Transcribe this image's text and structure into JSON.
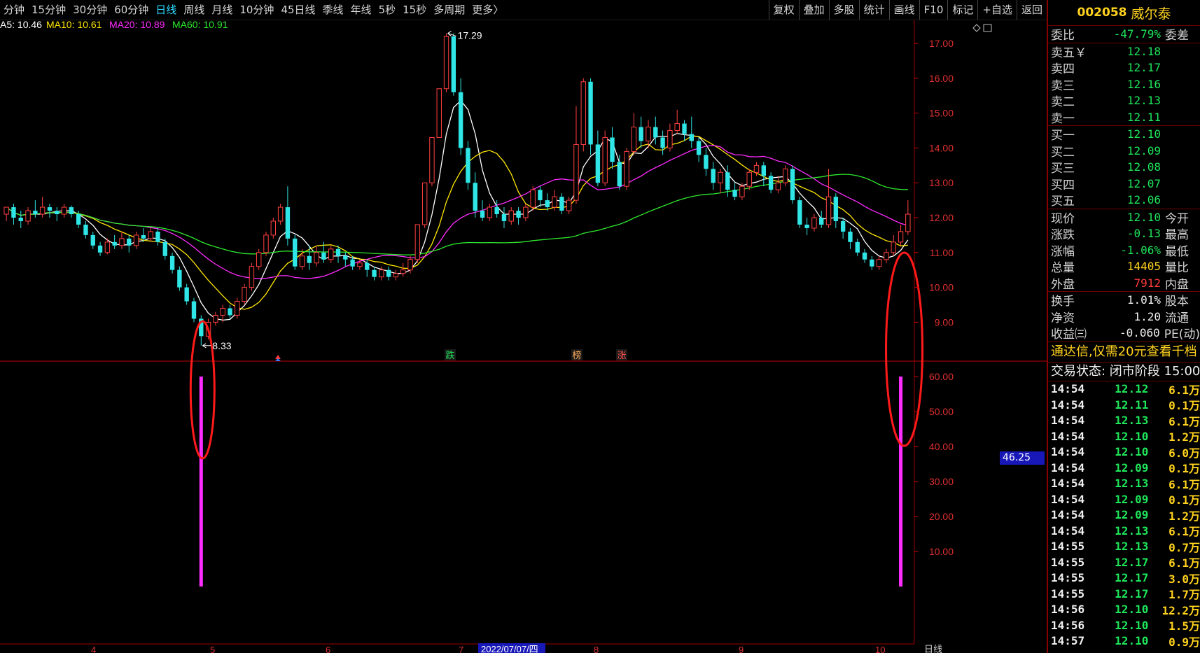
{
  "toolbar": {
    "periods": [
      {
        "label": "分钟",
        "active": false
      },
      {
        "label": "15分钟",
        "active": false
      },
      {
        "label": "30分钟",
        "active": false
      },
      {
        "label": "60分钟",
        "active": false
      },
      {
        "label": "日线",
        "active": true
      },
      {
        "label": "周线",
        "active": false
      },
      {
        "label": "月线",
        "active": false
      },
      {
        "label": "10分钟",
        "active": false
      },
      {
        "label": "45日线",
        "active": false
      },
      {
        "label": "季线",
        "active": false
      },
      {
        "label": "年线",
        "active": false
      },
      {
        "label": "5秒",
        "active": false
      },
      {
        "label": "15秒",
        "active": false
      },
      {
        "label": "多周期",
        "active": false
      },
      {
        "label": "更多〉",
        "active": false
      }
    ],
    "tools": [
      "复权",
      "叠加",
      "多股",
      "统计",
      "画线",
      "F10",
      "标记",
      "+自选",
      "返回"
    ]
  },
  "indicators": [
    {
      "label": "A5: 10.46",
      "color": "#ffffff"
    },
    {
      "label": "MA10: 10.61",
      "color": "#ffe600"
    },
    {
      "label": "MA20: 10.89",
      "color": "#ff2cff"
    },
    {
      "label": "MA60: 10.91",
      "color": "#2ee82e"
    }
  ],
  "price_axis": [
    "17.00",
    "16.00",
    "15.00",
    "14.00",
    "13.00",
    "12.00",
    "11.00",
    "10.00",
    "9.00"
  ],
  "sub_axis": [
    "60.00",
    "50.00",
    "40.00",
    "30.00",
    "20.00",
    "10.00"
  ],
  "sub_value_tag": "46.25",
  "chart_annotations": {
    "high": "17.29",
    "low": "8.33"
  },
  "event_markers": [
    "跌",
    "榜",
    "涨"
  ],
  "date_axis": {
    "months": [
      "4",
      "5",
      "6",
      "7",
      "8",
      "9",
      "10"
    ],
    "cursor_date": "2022/07/07/四",
    "right_label": "日线"
  },
  "chart_data": {
    "type": "candlestick",
    "price_range": [
      8.2,
      17.6
    ],
    "sub_range": [
      0,
      65
    ],
    "candles": [
      [
        12.1,
        12.3,
        12.3,
        11.9
      ],
      [
        12.3,
        12.0,
        12.4,
        11.8
      ],
      [
        12.0,
        11.9,
        12.2,
        11.7
      ],
      [
        11.9,
        12.2,
        12.3,
        11.8
      ],
      [
        12.2,
        12.1,
        12.5,
        12.0
      ],
      [
        12.1,
        12.3,
        12.6,
        12.0
      ],
      [
        12.3,
        12.2,
        12.4,
        12.0
      ],
      [
        12.2,
        12.1,
        12.3,
        11.9
      ],
      [
        12.1,
        12.3,
        12.4,
        12.0
      ],
      [
        12.3,
        12.1,
        12.35,
        12.0
      ],
      [
        12.1,
        11.8,
        12.2,
        11.7
      ],
      [
        11.8,
        11.5,
        11.9,
        11.4
      ],
      [
        11.5,
        11.2,
        11.6,
        11.1
      ],
      [
        11.2,
        11.0,
        11.3,
        10.9
      ],
      [
        11.0,
        11.3,
        11.4,
        10.95
      ],
      [
        11.3,
        11.2,
        11.5,
        11.1
      ],
      [
        11.2,
        11.4,
        11.6,
        11.1
      ],
      [
        11.4,
        11.2,
        11.5,
        11.0
      ],
      [
        11.2,
        11.5,
        11.6,
        11.1
      ],
      [
        11.5,
        11.4,
        11.7,
        11.3
      ],
      [
        11.4,
        11.6,
        11.7,
        11.3
      ],
      [
        11.6,
        11.3,
        11.7,
        11.2
      ],
      [
        11.3,
        10.9,
        11.4,
        10.8
      ],
      [
        10.9,
        10.5,
        11.0,
        10.4
      ],
      [
        10.5,
        10.0,
        10.6,
        9.9
      ],
      [
        10.0,
        9.6,
        10.1,
        9.5
      ],
      [
        9.6,
        9.1,
        9.7,
        9.0
      ],
      [
        9.1,
        8.6,
        9.2,
        8.33
      ],
      [
        8.6,
        9.0,
        9.1,
        8.5
      ],
      [
        9.0,
        9.2,
        9.3,
        8.9
      ],
      [
        9.2,
        9.4,
        9.5,
        9.0
      ],
      [
        9.4,
        9.2,
        9.5,
        9.1
      ],
      [
        9.2,
        9.6,
        9.7,
        9.1
      ],
      [
        9.6,
        10.0,
        10.1,
        9.5
      ],
      [
        10.0,
        10.6,
        10.7,
        9.9
      ],
      [
        10.6,
        11.0,
        11.1,
        10.5
      ],
      [
        11.0,
        11.5,
        11.6,
        10.9
      ],
      [
        11.5,
        11.9,
        12.0,
        11.4
      ],
      [
        11.9,
        12.3,
        12.4,
        11.8
      ],
      [
        12.3,
        11.4,
        12.9,
        11.2
      ],
      [
        11.4,
        10.6,
        11.5,
        10.5
      ],
      [
        10.6,
        10.9,
        11.1,
        10.5
      ],
      [
        10.9,
        10.7,
        11.2,
        10.5
      ],
      [
        10.7,
        11.0,
        11.2,
        10.6
      ],
      [
        11.0,
        10.8,
        11.3,
        10.7
      ],
      [
        10.8,
        11.1,
        11.2,
        10.7
      ],
      [
        11.1,
        10.9,
        11.2,
        10.7
      ],
      [
        10.9,
        10.8,
        11.0,
        10.6
      ],
      [
        10.8,
        10.6,
        10.9,
        10.5
      ],
      [
        10.6,
        10.7,
        10.8,
        10.5
      ],
      [
        10.7,
        10.5,
        10.8,
        10.3
      ],
      [
        10.5,
        10.3,
        10.6,
        10.2
      ],
      [
        10.3,
        10.5,
        10.6,
        10.2
      ],
      [
        10.5,
        10.3,
        10.6,
        10.2
      ],
      [
        10.3,
        10.4,
        10.5,
        10.2
      ],
      [
        10.4,
        10.5,
        10.7,
        10.3
      ],
      [
        10.5,
        10.8,
        10.9,
        10.4
      ],
      [
        10.8,
        11.8,
        11.8,
        10.7
      ],
      [
        11.8,
        13.0,
        13.0,
        11.7
      ],
      [
        13.0,
        14.3,
        14.3,
        12.9
      ],
      [
        14.3,
        15.7,
        15.7,
        14.3
      ],
      [
        15.7,
        17.2,
        17.29,
        15.6
      ],
      [
        17.2,
        15.6,
        17.29,
        15.5
      ],
      [
        15.6,
        14.0,
        16.0,
        13.8
      ],
      [
        14.0,
        13.0,
        14.2,
        12.8
      ],
      [
        13.0,
        12.2,
        13.3,
        12.0
      ],
      [
        12.2,
        12.0,
        12.5,
        11.9
      ],
      [
        12.0,
        12.3,
        12.4,
        11.9
      ],
      [
        12.3,
        12.1,
        12.5,
        12.0
      ],
      [
        12.1,
        11.9,
        12.3,
        11.7
      ],
      [
        11.9,
        12.2,
        12.3,
        11.8
      ],
      [
        12.2,
        12.0,
        12.3,
        11.8
      ],
      [
        12.0,
        12.3,
        12.4,
        11.9
      ],
      [
        12.3,
        12.8,
        12.9,
        12.2
      ],
      [
        12.8,
        12.5,
        12.9,
        12.3
      ],
      [
        12.5,
        12.3,
        12.7,
        12.2
      ],
      [
        12.3,
        12.6,
        12.8,
        12.2
      ],
      [
        12.6,
        12.2,
        12.7,
        12.1
      ],
      [
        12.2,
        12.5,
        12.6,
        12.1
      ],
      [
        12.5,
        14.1,
        15.2,
        12.4
      ],
      [
        14.1,
        15.9,
        16.0,
        13.9
      ],
      [
        15.9,
        14.1,
        16.0,
        13.8
      ],
      [
        14.1,
        13.0,
        14.5,
        12.9
      ],
      [
        13.0,
        14.3,
        14.5,
        12.9
      ],
      [
        14.3,
        13.6,
        14.6,
        13.4
      ],
      [
        13.6,
        12.9,
        13.8,
        12.8
      ],
      [
        12.9,
        13.9,
        14.0,
        12.8
      ],
      [
        13.9,
        14.6,
        15.0,
        13.8
      ],
      [
        14.6,
        14.2,
        14.9,
        14.0
      ],
      [
        14.2,
        14.6,
        14.8,
        14.0
      ],
      [
        14.6,
        14.3,
        14.9,
        14.1
      ],
      [
        14.3,
        14.0,
        14.5,
        13.8
      ],
      [
        14.0,
        14.5,
        14.7,
        13.9
      ],
      [
        14.5,
        14.7,
        15.1,
        14.4
      ],
      [
        14.7,
        14.4,
        14.8,
        14.2
      ],
      [
        14.4,
        14.2,
        14.9,
        14.0
      ],
      [
        14.2,
        13.8,
        14.3,
        13.6
      ],
      [
        13.8,
        13.4,
        14.0,
        13.2
      ],
      [
        13.4,
        13.0,
        13.6,
        12.8
      ],
      [
        13.0,
        13.3,
        13.4,
        12.7
      ],
      [
        13.3,
        12.8,
        13.5,
        12.6
      ],
      [
        12.8,
        12.6,
        13.0,
        12.5
      ],
      [
        12.6,
        12.9,
        13.0,
        12.5
      ],
      [
        12.9,
        13.3,
        13.4,
        12.8
      ],
      [
        13.3,
        13.5,
        13.6,
        13.2
      ],
      [
        13.5,
        13.2,
        13.6,
        12.9
      ],
      [
        13.2,
        12.8,
        13.3,
        12.7
      ],
      [
        12.8,
        13.0,
        13.2,
        12.7
      ],
      [
        13.0,
        13.4,
        13.5,
        12.9
      ],
      [
        13.4,
        12.5,
        13.5,
        12.4
      ],
      [
        12.5,
        11.8,
        12.6,
        11.7
      ],
      [
        11.8,
        11.7,
        12.0,
        11.5
      ],
      [
        11.7,
        12.0,
        12.1,
        11.6
      ],
      [
        12.0,
        11.8,
        12.2,
        11.7
      ],
      [
        11.8,
        12.6,
        13.4,
        11.7
      ],
      [
        12.6,
        11.9,
        12.7,
        11.7
      ],
      [
        11.9,
        11.6,
        12.0,
        11.4
      ],
      [
        11.6,
        11.3,
        11.7,
        11.1
      ],
      [
        11.3,
        11.0,
        11.4,
        10.9
      ],
      [
        11.0,
        10.8,
        11.1,
        10.7
      ],
      [
        10.8,
        10.6,
        10.9,
        10.5
      ],
      [
        10.6,
        10.8,
        10.9,
        10.5
      ],
      [
        10.8,
        11.0,
        11.1,
        10.7
      ],
      [
        11.0,
        11.3,
        11.5,
        10.9
      ],
      [
        11.3,
        11.6,
        11.8,
        11.2
      ],
      [
        11.6,
        12.1,
        12.5,
        11.5
      ]
    ],
    "signals": [
      {
        "index": 27,
        "value": 60
      },
      {
        "index": 124,
        "value": 60
      }
    ]
  },
  "panel": {
    "code": "002058",
    "name": "威尔泰",
    "ratio": {
      "label": "委比",
      "value": "-47.79%",
      "label2": "委差"
    },
    "asks": [
      {
        "label": "卖五￥",
        "price": "12.18"
      },
      {
        "label": "卖四",
        "price": "12.17"
      },
      {
        "label": "卖三",
        "price": "12.16"
      },
      {
        "label": "卖二",
        "price": "12.13"
      },
      {
        "label": "卖一",
        "price": "12.11"
      }
    ],
    "bids": [
      {
        "label": "买一",
        "price": "12.10"
      },
      {
        "label": "买二",
        "price": "12.09"
      },
      {
        "label": "买三",
        "price": "12.08"
      },
      {
        "label": "买四",
        "price": "12.07"
      },
      {
        "label": "买五",
        "price": "12.06"
      }
    ],
    "quote": [
      {
        "label": "现价",
        "value": "12.10",
        "label2": "今开",
        "color": "green"
      },
      {
        "label": "涨跌",
        "value": "-0.13",
        "label2": "最高",
        "color": "green"
      },
      {
        "label": "涨幅",
        "value": "-1.06%",
        "label2": "最低",
        "color": "green"
      },
      {
        "label": "总量",
        "value": "14405",
        "label2": "量比",
        "color": "yellow"
      },
      {
        "label": "外盘",
        "value": "7912",
        "label2": "内盘",
        "color": "red"
      }
    ],
    "fundamentals": [
      {
        "label": "换手",
        "value": "1.01%",
        "label2": "股本",
        "color": "white"
      },
      {
        "label": "净资",
        "value": "1.20",
        "label2": "流通",
        "color": "white"
      },
      {
        "label": "收益㈢",
        "value": "-0.060",
        "label2": "PE(动)",
        "color": "white"
      }
    ],
    "promo": "通达信,仅需20元查看千档",
    "status": "交易状态: 闭市阶段 15:00",
    "ticks": [
      {
        "time": "14:54",
        "price": "12.12",
        "vol": "6.1万",
        "color": "green"
      },
      {
        "time": "14:54",
        "price": "12.11",
        "vol": "0.1万",
        "color": "green"
      },
      {
        "time": "14:54",
        "price": "12.13",
        "vol": "6.1万",
        "color": "green"
      },
      {
        "time": "14:54",
        "price": "12.10",
        "vol": "1.2万",
        "color": "green"
      },
      {
        "time": "14:54",
        "price": "12.10",
        "vol": "6.0万",
        "color": "green"
      },
      {
        "time": "14:54",
        "price": "12.09",
        "vol": "0.1万",
        "color": "green"
      },
      {
        "time": "14:54",
        "price": "12.13",
        "vol": "6.1万",
        "color": "green"
      },
      {
        "time": "14:54",
        "price": "12.09",
        "vol": "0.1万",
        "color": "green"
      },
      {
        "time": "14:54",
        "price": "12.09",
        "vol": "1.2万",
        "color": "green"
      },
      {
        "time": "14:54",
        "price": "12.13",
        "vol": "6.1万",
        "color": "green"
      },
      {
        "time": "14:55",
        "price": "12.13",
        "vol": "0.7万",
        "color": "green"
      },
      {
        "time": "14:55",
        "price": "12.17",
        "vol": "6.1万",
        "color": "green"
      },
      {
        "time": "14:55",
        "price": "12.17",
        "vol": "3.0万",
        "color": "green"
      },
      {
        "time": "14:55",
        "price": "12.17",
        "vol": "1.7万",
        "color": "green"
      },
      {
        "time": "14:56",
        "price": "12.10",
        "vol": "12.2万",
        "color": "green"
      },
      {
        "time": "14:56",
        "price": "12.10",
        "vol": "1.5万",
        "color": "green"
      },
      {
        "time": "14:57",
        "price": "12.10",
        "vol": "0.9万",
        "color": "green"
      }
    ]
  }
}
